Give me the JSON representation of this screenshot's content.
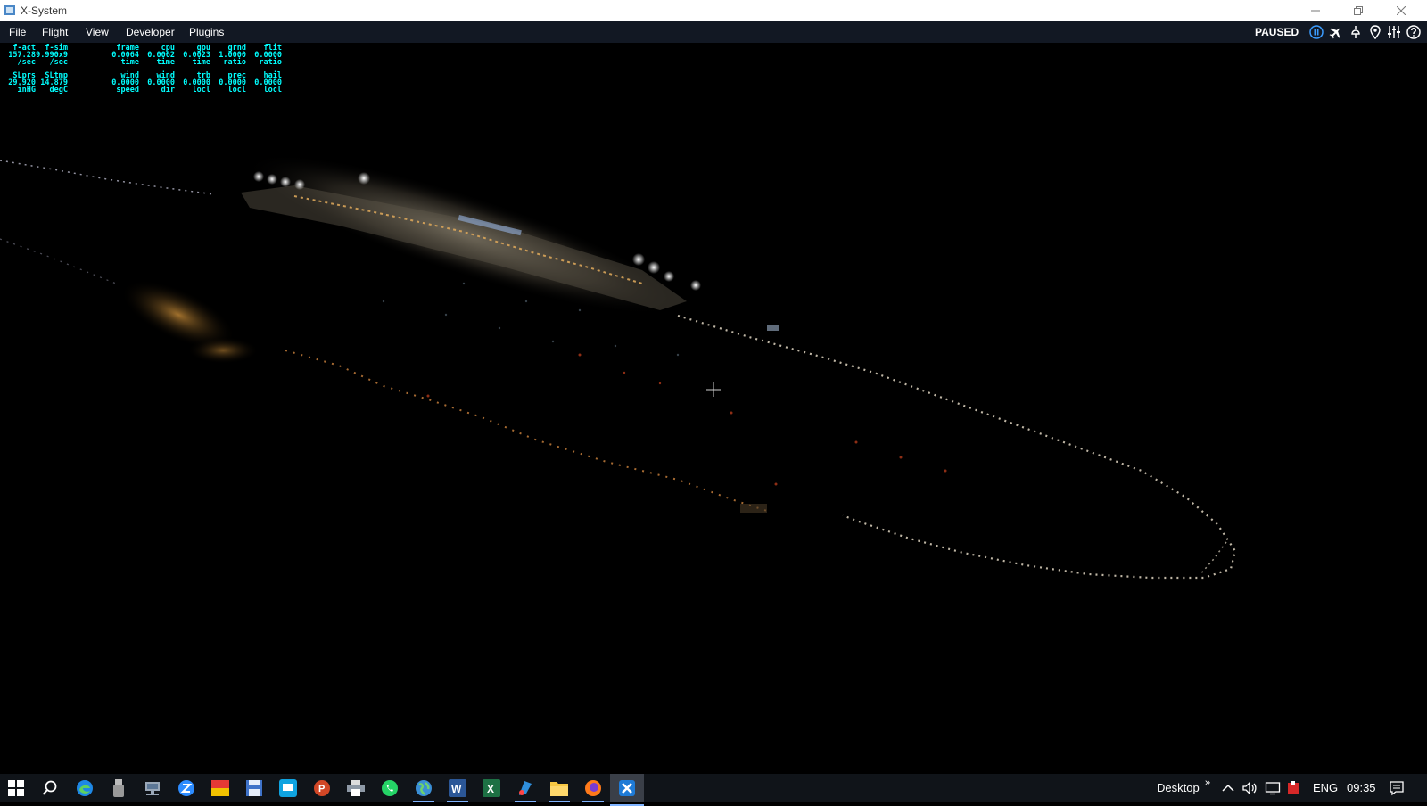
{
  "window": {
    "title": "X-System"
  },
  "menu": [
    "File",
    "Flight",
    "View",
    "Developer",
    "Plugins"
  ],
  "status": {
    "paused_label": "PAUSED"
  },
  "toolbar_icons": [
    "pause-icon",
    "airplane-icon",
    "weather-icon",
    "location-pin-icon",
    "settings-sliders-icon",
    "help-icon"
  ],
  "stats": {
    "row1": [
      {
        "label": "f-act",
        "value": "157.28",
        "unit": "/sec"
      },
      {
        "label": "f-sim",
        "value": "9.990x9",
        "unit": "/sec"
      },
      {
        "label": "frame",
        "value": "0.0064",
        "unit": "time"
      },
      {
        "label": "cpu",
        "value": "0.0062",
        "unit": "time"
      },
      {
        "label": "gpu",
        "value": "0.0023",
        "unit": "time"
      },
      {
        "label": "grnd",
        "value": "1.0000",
        "unit": "ratio"
      },
      {
        "label": "flit",
        "value": "0.0000",
        "unit": "ratio"
      }
    ],
    "row2": [
      {
        "label": "SLprs",
        "value": "29.920",
        "unit": "inHG"
      },
      {
        "label": "SLtmp",
        "value": "14.879",
        "unit": "degC"
      },
      {
        "label": "wind",
        "value": "0.0000",
        "unit": "speed"
      },
      {
        "label": "wind",
        "value": "0.0000",
        "unit": "dir"
      },
      {
        "label": "trb",
        "value": "0.0000",
        "unit": "locl"
      },
      {
        "label": "prec",
        "value": "0.0000",
        "unit": "locl"
      },
      {
        "label": "hail",
        "value": "0.0000",
        "unit": "locl"
      }
    ]
  },
  "taskbar": {
    "apps": [
      "windows-start-icon",
      "search-icon",
      "edge-icon",
      "usb-drive-icon",
      "network-drive-icon",
      "zoom-icon",
      "flag-app-icon",
      "save-disk-icon",
      "screen-app-icon",
      "powerpoint-icon",
      "printer-icon",
      "whatsapp-icon",
      "globe-icon",
      "word-icon",
      "excel-icon",
      "paint-icon",
      "file-explorer-icon",
      "firefox-icon",
      "xplane-icon"
    ],
    "active_apps": [
      "globe-icon",
      "word-icon",
      "paint-icon",
      "file-explorer-icon",
      "firefox-icon",
      "xplane-icon"
    ],
    "desktop_label": "Desktop",
    "language": "ENG",
    "time": "09:35"
  },
  "colors": {
    "stats_text": "#00ffff",
    "menubar_bg": "#121823",
    "taskbar_bg": "#101419",
    "accent": "#3b9cff"
  }
}
